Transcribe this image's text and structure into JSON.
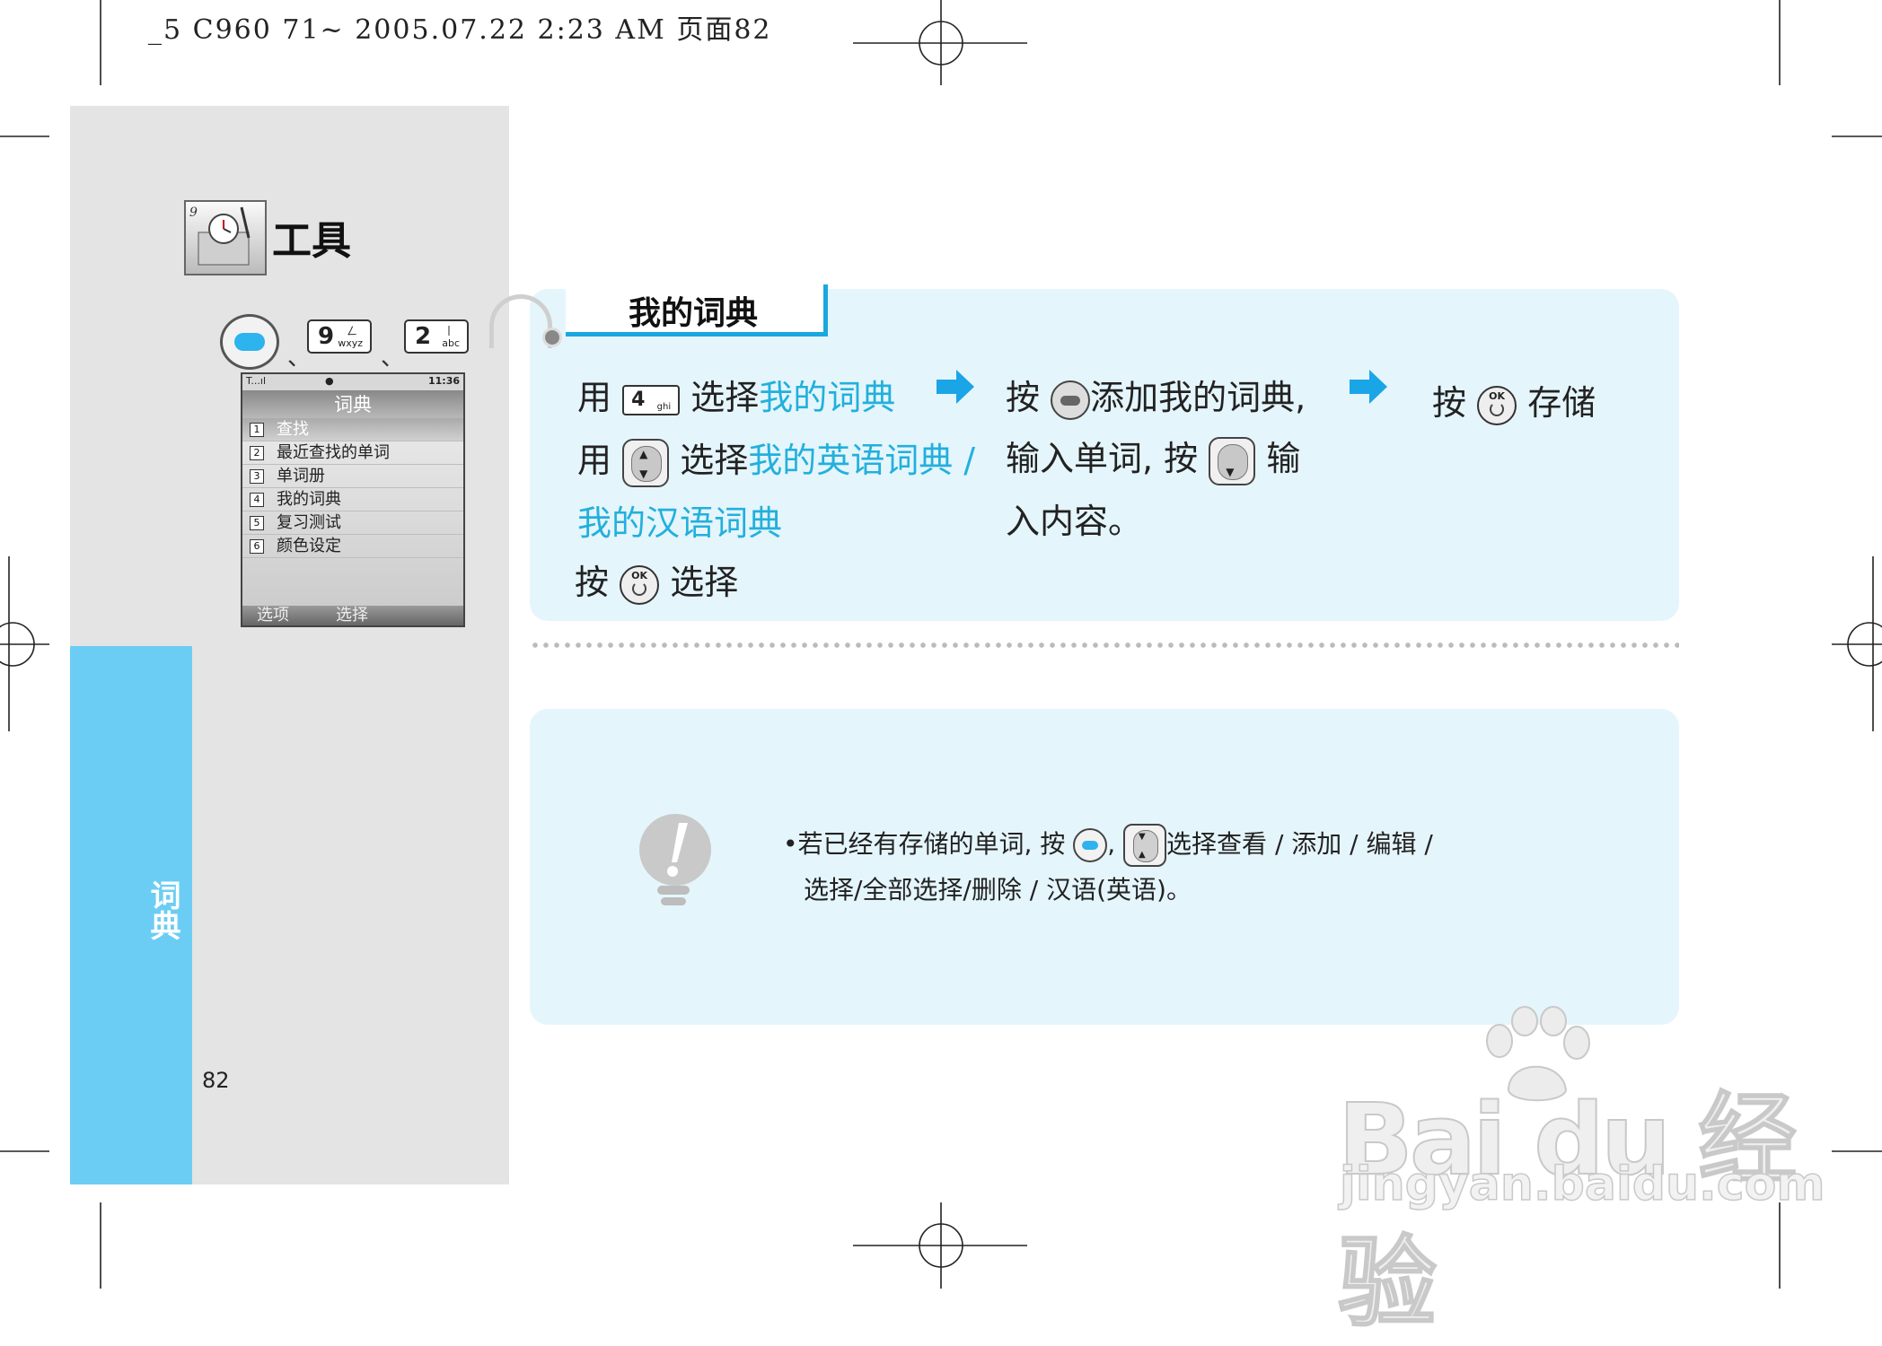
{
  "print_header": "_5 C960 71~ 2005.07.22 2:23 AM 页面82",
  "section": {
    "title": "工具",
    "tab_label": "词典",
    "page_number": "82"
  },
  "key_sequence": {
    "separator": "、",
    "keys": [
      {
        "digit": "9",
        "letters": "wxyz",
        "mark": "ㄥ"
      },
      {
        "digit": "2",
        "letters": "abc",
        "mark": "丨"
      }
    ]
  },
  "phone": {
    "status": "T...ıl",
    "clock": "11:36",
    "title": "词典",
    "items": [
      {
        "num": "1",
        "label": "查找"
      },
      {
        "num": "2",
        "label": "最近查找的单词"
      },
      {
        "num": "3",
        "label": "单词册"
      },
      {
        "num": "4",
        "label": "我的词典"
      },
      {
        "num": "5",
        "label": "复习测试"
      },
      {
        "num": "6",
        "label": "颜色设定"
      }
    ],
    "soft_left": "选项",
    "soft_right": "选择"
  },
  "dictionary_section": {
    "heading": "我的词典",
    "step1": {
      "use": "用",
      "key_digit": "4",
      "key_letters": "ghi",
      "select": "选择",
      "my_dict": "我的词典",
      "use2": "用",
      "select2": "选择",
      "my_english": "我的英语词典 /",
      "my_chinese": "我的汉语词典",
      "press": "按",
      "select3": "选择"
    },
    "step2": {
      "press": "按",
      "add": "添加我的词典,",
      "input_word": "输入单词, 按",
      "input": "输",
      "content": "入内容。"
    },
    "step3": {
      "press": "按",
      "save": "存储"
    }
  },
  "note": {
    "bullet": "•",
    "line1_a": "若已经有存储的单词, 按",
    "line1_b": ",",
    "line1_c": "选择查看 / 添加 / 编辑 /",
    "line2": "选择/全部选择/删除 / 汉语(英语)。"
  },
  "watermark": {
    "logo": "Bai du 经验",
    "url": "jingyan.baidu.com"
  },
  "colors": {
    "accent": "#22b0dc",
    "tab_blue": "#6ccdf4",
    "panel": "#e5f5fc",
    "gray_column": "#e4e4e4"
  },
  "icons": [
    "tools-icon",
    "menu-key-icon",
    "ok-key-icon",
    "navigation-key-icon",
    "soft-key-icon",
    "arrow-right-icon",
    "lightbulb-icon",
    "baidu-paw-icon"
  ]
}
